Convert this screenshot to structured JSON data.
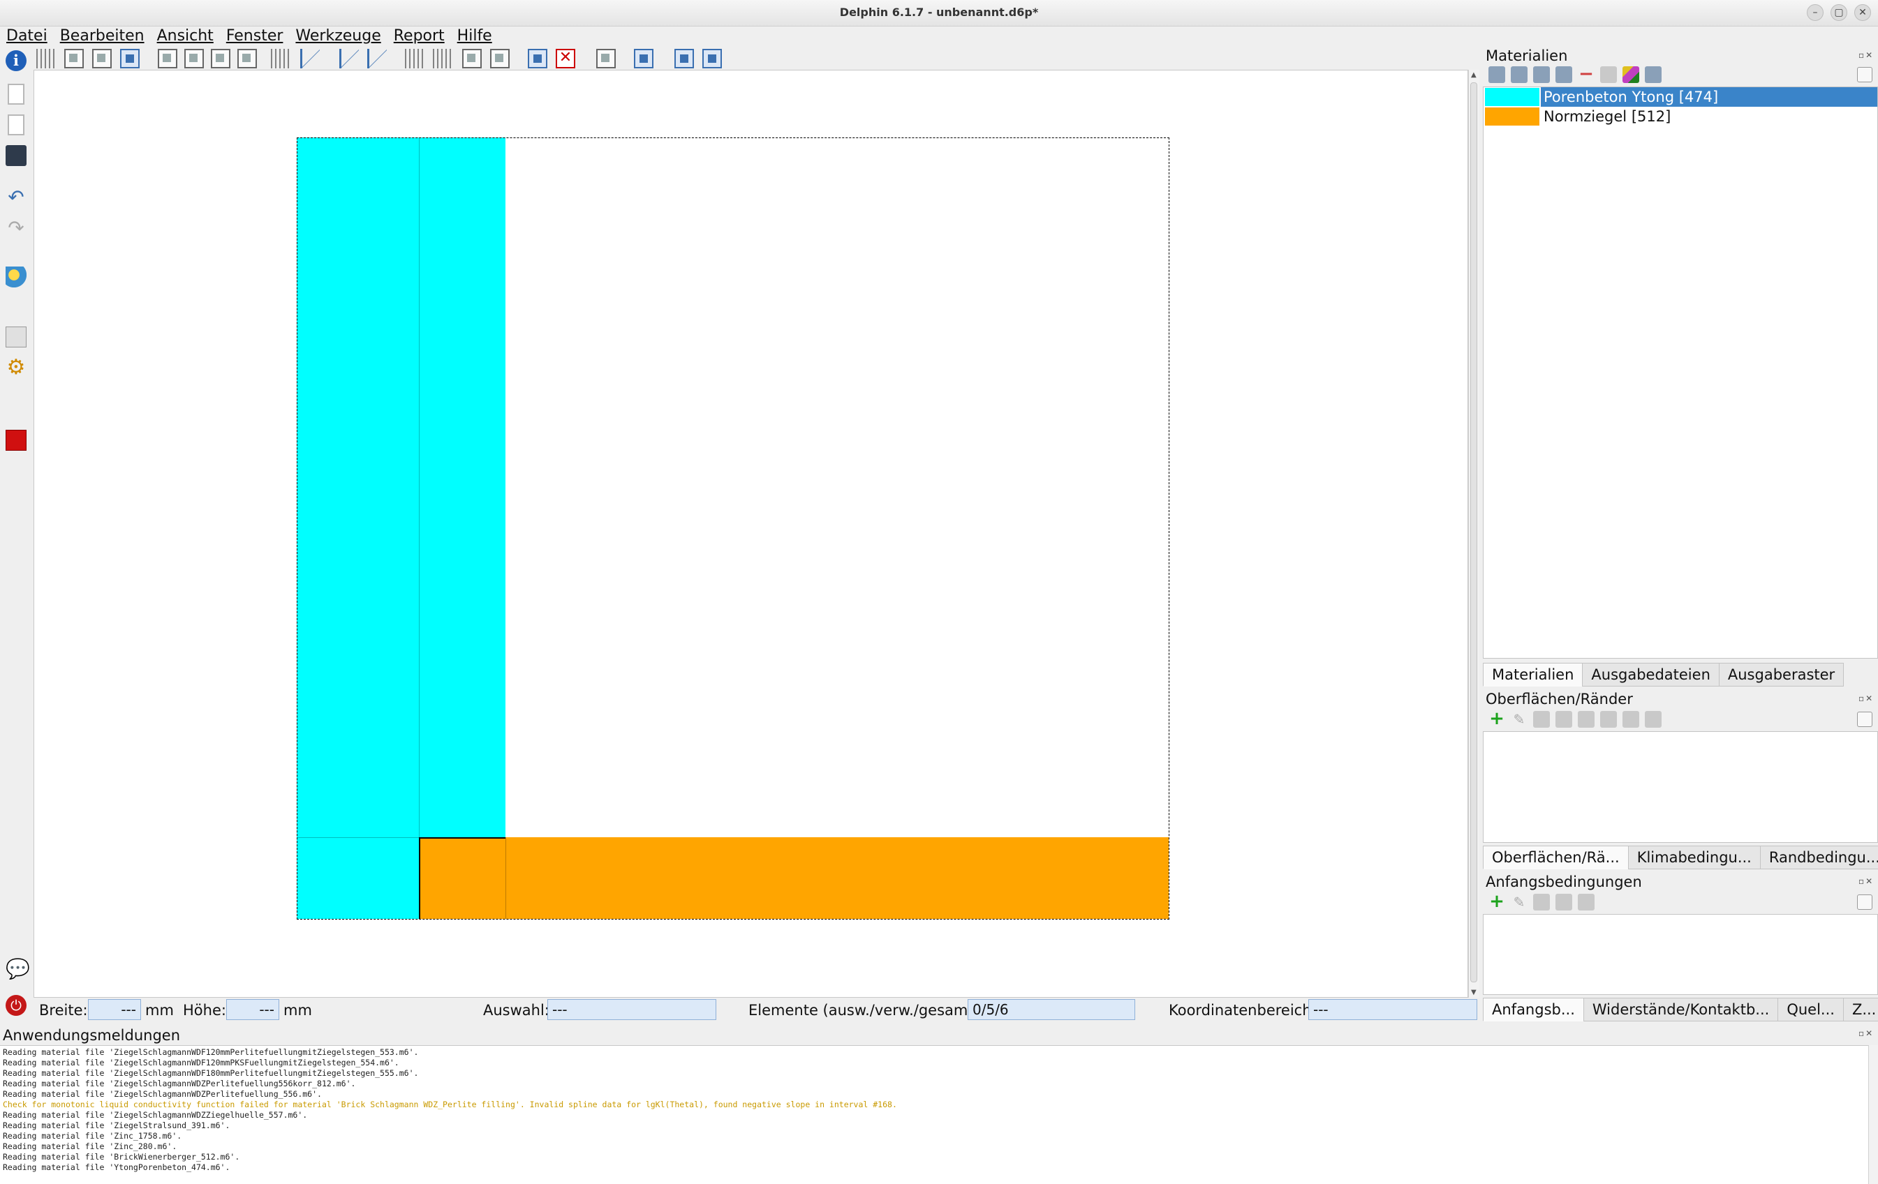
{
  "window": {
    "title": "Delphin 6.1.7 - unbenannt.d6p*"
  },
  "menu": [
    "Datei",
    "Bearbeiten",
    "Ansicht",
    "Fenster",
    "Werkzeuge",
    "Report",
    "Hilfe"
  ],
  "status": {
    "breite_label": "Breite:",
    "breite_value": "---",
    "breite_unit": "mm",
    "hoehe_label": "Höhe:",
    "hoehe_value": "---",
    "hoehe_unit": "mm",
    "auswahl_label": "Auswahl:",
    "auswahl_value": "---",
    "elemente_label": "Elemente (ausw./verw./gesamt):",
    "elemente_value": "0/5/6",
    "koord_label": "Koordinatenbereich:",
    "koord_value": "---"
  },
  "materials_panel": {
    "title": "Materialien",
    "items": [
      {
        "name": "Porenbeton Ytong [474]",
        "color": "#00ffff",
        "selected": true
      },
      {
        "name": "Normziegel [512]",
        "color": "#ffa500",
        "selected": false
      }
    ],
    "tabs": [
      "Materialien",
      "Ausgabedateien",
      "Ausgaberaster"
    ]
  },
  "surfaces_panel": {
    "title": "Oberflächen/Ränder",
    "tabs": [
      "Oberflächen/Rä...",
      "Klimabedingu...",
      "Randbedingu..."
    ]
  },
  "initial_panel": {
    "title": "Anfangsbedingungen",
    "tabs": [
      "Anfangsb...",
      "Widerstände/Kontaktb...",
      "Quel...",
      "Z..."
    ]
  },
  "messages": {
    "title": "Anwendungsmeldungen",
    "lines": [
      {
        "text": "Reading material file 'ZiegelSchlagmannWDF120mmPerlitefuellungmitZiegelstegen_553.m6'.",
        "warn": false
      },
      {
        "text": "Reading material file 'ZiegelSchlagmannWDF120mmPKSFuellungmitZiegelstegen_554.m6'.",
        "warn": false
      },
      {
        "text": "Reading material file 'ZiegelSchlagmannWDF180mmPerlitefuellungmitZiegelstegen_555.m6'.",
        "warn": false
      },
      {
        "text": "Reading material file 'ZiegelSchlagmannWDZPerlitefuellung556korr_812.m6'.",
        "warn": false
      },
      {
        "text": "Reading material file 'ZiegelSchlagmannWDZPerlitefuellung_556.m6'.",
        "warn": false
      },
      {
        "text": "Check for monotonic liquid conductivity function failed for material 'Brick Schlagmann WDZ_Perlite filling'. Invalid spline data for lgKl(Thetal), found negative slope in interval #168.",
        "warn": true
      },
      {
        "text": "Reading material file 'ZiegelSchlagmannWDZZiegelhuelle_557.m6'.",
        "warn": false
      },
      {
        "text": "Reading material file 'ZiegelStralsund_391.m6'.",
        "warn": false
      },
      {
        "text": "Reading material file 'Zinc_1758.m6'.",
        "warn": false
      },
      {
        "text": "Reading material file 'Zinc_280.m6'.",
        "warn": false
      },
      {
        "text": "Reading material file 'BrickWienerberger_512.m6'.",
        "warn": false
      },
      {
        "text": "Reading material file 'YtongPorenbeton_474.m6'.",
        "warn": false
      }
    ]
  },
  "icons": {
    "info": "info-icon",
    "new": "new-document-icon",
    "open": "open-file-icon",
    "save": "save-icon",
    "undo": "undo-icon",
    "redo": "redo-icon",
    "globe": "climate-globe-icon",
    "chart": "postproc-chart-icon",
    "gear": "settings-gear-icon",
    "stop": "stop-icon",
    "chat": "chat-icon",
    "power": "power-icon",
    "delete": "delete-x-icon"
  },
  "colors": {
    "ytong": "#00ffff",
    "ziegel": "#ffa500",
    "selection": "#3a84c9",
    "field_bg": "#dce9f8"
  }
}
